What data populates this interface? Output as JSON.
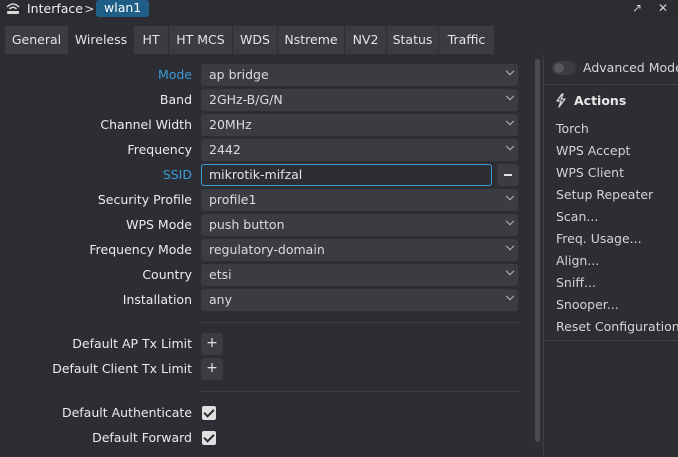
{
  "window": {
    "title": "Interface",
    "separator": ">",
    "chip": "wlan1",
    "restore_icon": "↗",
    "close_icon": "✕"
  },
  "tabs": [
    {
      "label": "General"
    },
    {
      "label": "Wireless"
    },
    {
      "label": "HT"
    },
    {
      "label": "HT MCS"
    },
    {
      "label": "WDS"
    },
    {
      "label": "Nstreme"
    },
    {
      "label": "NV2"
    },
    {
      "label": "Status"
    },
    {
      "label": "Traffic"
    }
  ],
  "active_tab": "Wireless",
  "form": {
    "mode": {
      "label": "Mode",
      "value": "ap bridge"
    },
    "band": {
      "label": "Band",
      "value": "2GHz-B/G/N"
    },
    "channel_width": {
      "label": "Channel Width",
      "value": "20MHz"
    },
    "frequency": {
      "label": "Frequency",
      "value": "2442"
    },
    "ssid": {
      "label": "SSID",
      "value": "mikrotik-mifzal"
    },
    "security_profile": {
      "label": "Security Profile",
      "value": "profile1"
    },
    "wps_mode": {
      "label": "WPS Mode",
      "value": "push button"
    },
    "frequency_mode": {
      "label": "Frequency Mode",
      "value": "regulatory-domain"
    },
    "country": {
      "label": "Country",
      "value": "etsi"
    },
    "installation": {
      "label": "Installation",
      "value": "any"
    },
    "default_ap_tx_limit": {
      "label": "Default AP Tx Limit",
      "button": "+"
    },
    "default_client_tx_limit": {
      "label": "Default Client Tx Limit",
      "button": "+"
    },
    "default_authenticate": {
      "label": "Default Authenticate",
      "checked": true
    },
    "default_forward": {
      "label": "Default Forward",
      "checked": true
    }
  },
  "sidebar": {
    "advanced_mode_label": "Advanced Mode",
    "advanced_mode_on": false,
    "actions_title": "Actions",
    "actions": [
      {
        "label": "Torch"
      },
      {
        "label": "WPS Accept"
      },
      {
        "label": "WPS Client"
      },
      {
        "label": "Setup Repeater"
      },
      {
        "label": "Scan..."
      },
      {
        "label": "Freq. Usage..."
      },
      {
        "label": "Align..."
      },
      {
        "label": "Sniff..."
      },
      {
        "label": "Snooper..."
      },
      {
        "label": "Reset Configuration"
      }
    ]
  },
  "colors": {
    "accent": "#3d9ad8",
    "chip": "#1f5f87",
    "background": "#2c2e33"
  }
}
